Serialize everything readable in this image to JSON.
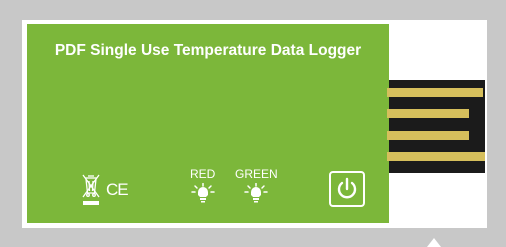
{
  "label": {
    "title": "PDF Single Use Temperature Data Logger",
    "ce_mark": "CE",
    "leds": [
      {
        "label": "RED"
      },
      {
        "label": "GREEN"
      }
    ]
  },
  "colors": {
    "label_green": "#7cb73a",
    "usb_pin_gold": "#d6bf5c",
    "usb_housing": "#1b1b1b",
    "background": "#c8c8c8"
  },
  "icons": [
    "weee-crossed-bin-icon",
    "ce-mark",
    "led-bulb-icon",
    "power-icon",
    "cursor-arrow-icon"
  ]
}
